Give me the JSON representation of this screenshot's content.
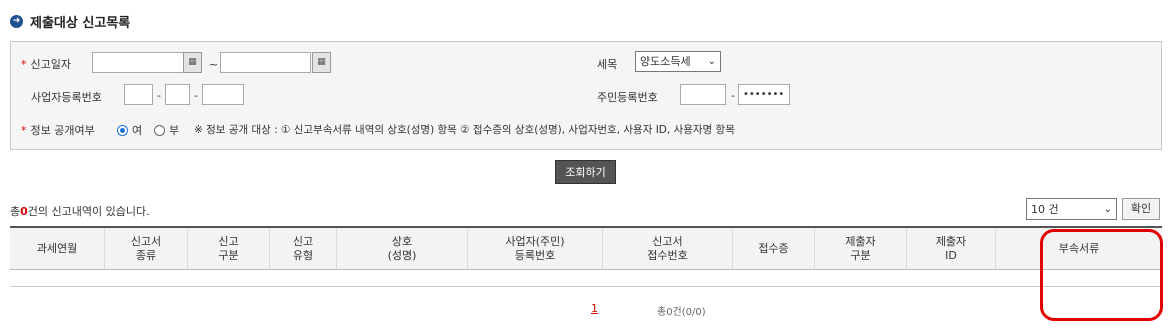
{
  "title": "제출대상 신고목록",
  "search": {
    "report_date_label": "신고일자",
    "range_sep": "~",
    "tax_item_label": "세목",
    "tax_item_value": "양도소득세",
    "biz_no_label": "사업자등록번호",
    "biz_sep": "-",
    "resident_no_label": "주민등록번호",
    "resident_mask": "•••••••",
    "disclosure_label": "정보 공개여부",
    "opt_yes": "여",
    "opt_no": "부",
    "disclosure_note": "※ 정보 공개 대상 : ① 신고부속서류 내역의 상호(성명) 항목 ② 접수증의 상호(성명), 사업자번호, 사용자 ID, 사용자명 항목"
  },
  "search_button": "조회하기",
  "result": {
    "prefix": "총",
    "count": "0",
    "suffix": "건의 신고내역이 있습니다.",
    "page_size": "10 건",
    "confirm_button": "확인"
  },
  "columns": [
    {
      "l1": "과세연월",
      "l2": ""
    },
    {
      "l1": "신고서",
      "l2": "종류"
    },
    {
      "l1": "신고",
      "l2": "구분"
    },
    {
      "l1": "신고",
      "l2": "유형"
    },
    {
      "l1": "상호",
      "l2": "(성명)"
    },
    {
      "l1": "사업자(주민)",
      "l2": "등록번호"
    },
    {
      "l1": "신고서",
      "l2": "접수번호"
    },
    {
      "l1": "접수증",
      "l2": ""
    },
    {
      "l1": "제출자",
      "l2": "구분"
    },
    {
      "l1": "제출자",
      "l2": "ID"
    },
    {
      "l1": "부속서류",
      "l2": ""
    }
  ],
  "pager": {
    "current": "1",
    "info": "총0건(0/0)"
  },
  "icons": {
    "title": "arrow-circle-icon",
    "calendar": "calendar-icon",
    "dropdown": "chevron-down-icon"
  },
  "colors": {
    "accent": "#1d4f91",
    "required": "#dd0000",
    "highlight": "#e00000"
  }
}
